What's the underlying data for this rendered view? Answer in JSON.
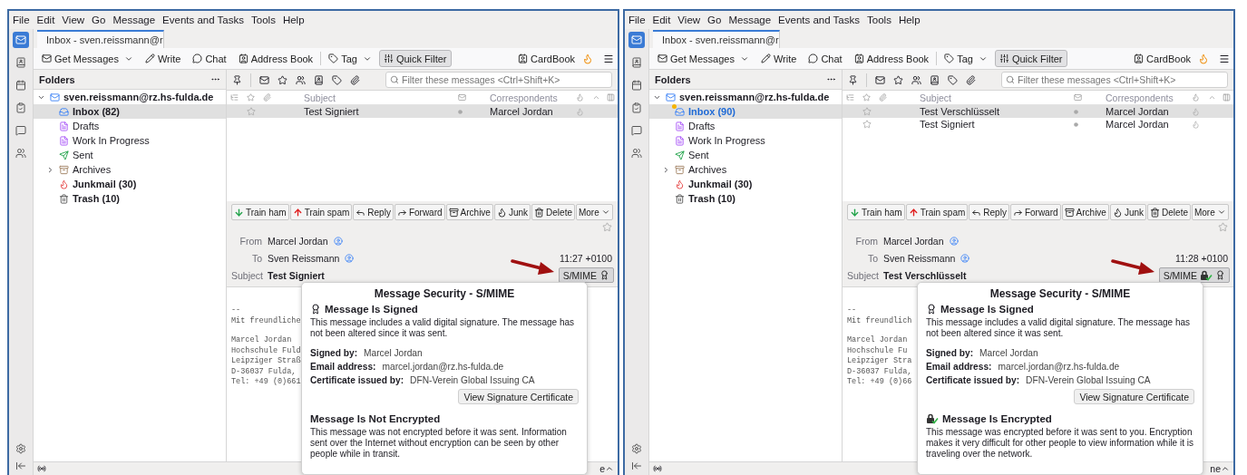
{
  "windows": [
    {
      "menu": [
        "File",
        "Edit",
        "View",
        "Go",
        "Message",
        "Events and Tasks",
        "Tools",
        "Help"
      ],
      "spaces": [
        {
          "kind": "mail",
          "selected": true
        },
        {
          "kind": "address-book",
          "selected": false
        },
        {
          "kind": "calendar",
          "selected": false
        },
        {
          "kind": "tasks",
          "selected": false
        },
        {
          "kind": "chat",
          "selected": false
        },
        {
          "kind": "contacts",
          "selected": false
        }
      ],
      "tab": {
        "label": "Inbox - sven.reissmann@r",
        "selected": true
      },
      "toolbar": [
        {
          "kind": "get-messages",
          "label": "Get Messages",
          "dropdown": true,
          "pressed": false
        },
        {
          "kind": "write",
          "label": "Write",
          "dropdown": false,
          "pressed": false
        },
        {
          "kind": "chat",
          "label": "Chat",
          "dropdown": false,
          "pressed": false
        },
        {
          "kind": "address-book",
          "label": "Address Book",
          "dropdown": false,
          "pressed": false
        },
        {
          "kind": "tag",
          "label": "Tag",
          "dropdown": true,
          "pressed": false
        },
        {
          "kind": "quick-filter",
          "label": "Quick Filter",
          "dropdown": false,
          "pressed": true
        }
      ],
      "cardbook": "CardBook",
      "folders": {
        "header": "Folders",
        "account": {
          "label": "sven.reissmann@rz.hs-fulda.de",
          "expanded": true,
          "children": [
            {
              "kind": "inbox",
              "label": "Inbox (82)",
              "bold": true,
              "selected": true,
              "new_mail": false,
              "collapsed": false
            },
            {
              "kind": "drafts",
              "label": "Drafts",
              "bold": false,
              "selected": false,
              "new_mail": false,
              "collapsed": false
            },
            {
              "kind": "drafts",
              "label": "Work In Progress",
              "bold": false,
              "selected": false,
              "new_mail": false,
              "collapsed": false
            },
            {
              "kind": "sent",
              "label": "Sent",
              "bold": false,
              "selected": false,
              "new_mail": false,
              "collapsed": false
            },
            {
              "kind": "archives",
              "label": "Archives",
              "bold": false,
              "selected": false,
              "new_mail": false,
              "collapsed": true
            },
            {
              "kind": "junk",
              "label": "Junkmail (30)",
              "bold": true,
              "selected": false,
              "new_mail": false,
              "collapsed": false
            },
            {
              "kind": "trash",
              "label": "Trash (10)",
              "bold": true,
              "selected": false,
              "new_mail": false,
              "collapsed": false
            }
          ]
        }
      },
      "quick_filter": {
        "placeholder": "Filter these messages <Ctrl+Shift+K>"
      },
      "columns": [
        "Subject",
        "Correspondents"
      ],
      "messages": [
        {
          "subject": "Test Signiert",
          "correspondent": "Marcel Jordan",
          "selected": true
        }
      ],
      "actions": [
        {
          "kind": "train-ham",
          "label": "Train ham"
        },
        {
          "kind": "train-spam",
          "label": "Train spam"
        },
        {
          "kind": "reply",
          "label": "Reply"
        },
        {
          "kind": "forward",
          "label": "Forward"
        },
        {
          "kind": "archive",
          "label": "Archive"
        },
        {
          "kind": "junk",
          "label": "Junk"
        },
        {
          "kind": "delete",
          "label": "Delete"
        },
        {
          "kind": "more",
          "label": "More"
        }
      ],
      "header": {
        "from_label": "From",
        "from": "Marcel Jordan",
        "to_label": "To",
        "to": "Sven Reissmann",
        "date": "11:27 +0100",
        "subject_label": "Subject",
        "subject": "Test Signiert",
        "smime": {
          "label": "S/MIME",
          "encrypted": false
        }
      },
      "body": [
        [
          "--",
          "Mit freundliche"
        ],
        [
          "Marcel Jordan",
          "Hochschule Fuld",
          "Leipziger Straß",
          "D-36037 Fulda,",
          "Tel: +49 (0)661"
        ]
      ],
      "popup": {
        "title": "Message Security - S/MIME",
        "signature": {
          "title": "Message Is Signed",
          "text": "This message includes a valid digital signature. The message has not been altered since it was sent.",
          "details": [
            {
              "label": "Signed by:",
              "value": "Marcel Jordan"
            },
            {
              "label": "Email address:",
              "value": "marcel.jordan@rz.hs-fulda.de"
            },
            {
              "label": "Certificate issued by:",
              "value": "DFN-Verein Global Issuing CA"
            }
          ],
          "button": "View Signature Certificate"
        },
        "encryption": {
          "encrypted": false,
          "title": "Message Is Not Encrypted",
          "text": "This message was not encrypted before it was sent. Information sent over the Internet without encryption can be seen by other people while in transit."
        }
      },
      "status": {
        "text": "e"
      }
    },
    {
      "menu": [
        "File",
        "Edit",
        "View",
        "Go",
        "Message",
        "Events and Tasks",
        "Tools",
        "Help"
      ],
      "spaces": [
        {
          "kind": "mail",
          "selected": true
        },
        {
          "kind": "address-book",
          "selected": false
        },
        {
          "kind": "calendar",
          "selected": false
        },
        {
          "kind": "tasks",
          "selected": false
        },
        {
          "kind": "chat",
          "selected": false
        },
        {
          "kind": "contacts",
          "selected": false
        }
      ],
      "tab": {
        "label": "Inbox - sven.reissmann@r",
        "selected": true
      },
      "toolbar": [
        {
          "kind": "get-messages",
          "label": "Get Messages",
          "dropdown": true,
          "pressed": false
        },
        {
          "kind": "write",
          "label": "Write",
          "dropdown": false,
          "pressed": false
        },
        {
          "kind": "chat",
          "label": "Chat",
          "dropdown": false,
          "pressed": false
        },
        {
          "kind": "address-book",
          "label": "Address Book",
          "dropdown": false,
          "pressed": false
        },
        {
          "kind": "tag",
          "label": "Tag",
          "dropdown": true,
          "pressed": false
        },
        {
          "kind": "quick-filter",
          "label": "Quick Filter",
          "dropdown": false,
          "pressed": true
        }
      ],
      "cardbook": "CardBook",
      "folders": {
        "header": "Folders",
        "account": {
          "label": "sven.reissmann@rz.hs-fulda.de",
          "expanded": true,
          "children": [
            {
              "kind": "inbox",
              "label": "Inbox (90)",
              "bold": true,
              "selected": true,
              "new_mail": true,
              "collapsed": false
            },
            {
              "kind": "drafts",
              "label": "Drafts",
              "bold": false,
              "selected": false,
              "new_mail": false,
              "collapsed": false
            },
            {
              "kind": "drafts",
              "label": "Work In Progress",
              "bold": false,
              "selected": false,
              "new_mail": false,
              "collapsed": false
            },
            {
              "kind": "sent",
              "label": "Sent",
              "bold": false,
              "selected": false,
              "new_mail": false,
              "collapsed": false
            },
            {
              "kind": "archives",
              "label": "Archives",
              "bold": false,
              "selected": false,
              "new_mail": false,
              "collapsed": true
            },
            {
              "kind": "junk",
              "label": "Junkmail (30)",
              "bold": true,
              "selected": false,
              "new_mail": false,
              "collapsed": false
            },
            {
              "kind": "trash",
              "label": "Trash (10)",
              "bold": true,
              "selected": false,
              "new_mail": false,
              "collapsed": false
            }
          ]
        }
      },
      "quick_filter": {
        "placeholder": "Filter these messages <Ctrl+Shift+K>"
      },
      "columns": [
        "Subject",
        "Correspondents"
      ],
      "messages": [
        {
          "subject": "Test Verschlüsselt",
          "correspondent": "Marcel Jordan",
          "selected": true
        },
        {
          "subject": "Test Signiert",
          "correspondent": "Marcel Jordan",
          "selected": false
        }
      ],
      "actions": [
        {
          "kind": "train-ham",
          "label": "Train ham"
        },
        {
          "kind": "train-spam",
          "label": "Train spam"
        },
        {
          "kind": "reply",
          "label": "Reply"
        },
        {
          "kind": "forward",
          "label": "Forward"
        },
        {
          "kind": "archive",
          "label": "Archive"
        },
        {
          "kind": "junk",
          "label": "Junk"
        },
        {
          "kind": "delete",
          "label": "Delete"
        },
        {
          "kind": "more",
          "label": "More"
        }
      ],
      "header": {
        "from_label": "From",
        "from": "Marcel Jordan",
        "to_label": "To",
        "to": "Sven Reissmann",
        "date": "11:28 +0100",
        "subject_label": "Subject",
        "subject": "Test Verschlüsselt",
        "smime": {
          "label": "S/MIME",
          "encrypted": true
        }
      },
      "body": [
        [
          "--",
          "Mit freundlich"
        ],
        [
          "Marcel Jordan",
          "Hochschule Fu",
          "Leipziger Stra",
          "D-36037 Fulda,",
          "Tel: +49 (0)66"
        ]
      ],
      "popup": {
        "title": "Message Security - S/MIME",
        "signature": {
          "title": "Message Is Signed",
          "text": "This message includes a valid digital signature. The message has not been altered since it was sent.",
          "details": [
            {
              "label": "Signed by:",
              "value": "Marcel Jordan"
            },
            {
              "label": "Email address:",
              "value": "marcel.jordan@rz.hs-fulda.de"
            },
            {
              "label": "Certificate issued by:",
              "value": "DFN-Verein Global Issuing CA"
            }
          ],
          "button": "View Signature Certificate"
        },
        "encryption": {
          "encrypted": true,
          "title": "Message Is Encrypted",
          "text": "This message was encrypted before it was sent to you. Encryption makes it very difficult for other people to view information while it is traveling over the network."
        }
      },
      "status": {
        "text": "ne"
      }
    }
  ]
}
